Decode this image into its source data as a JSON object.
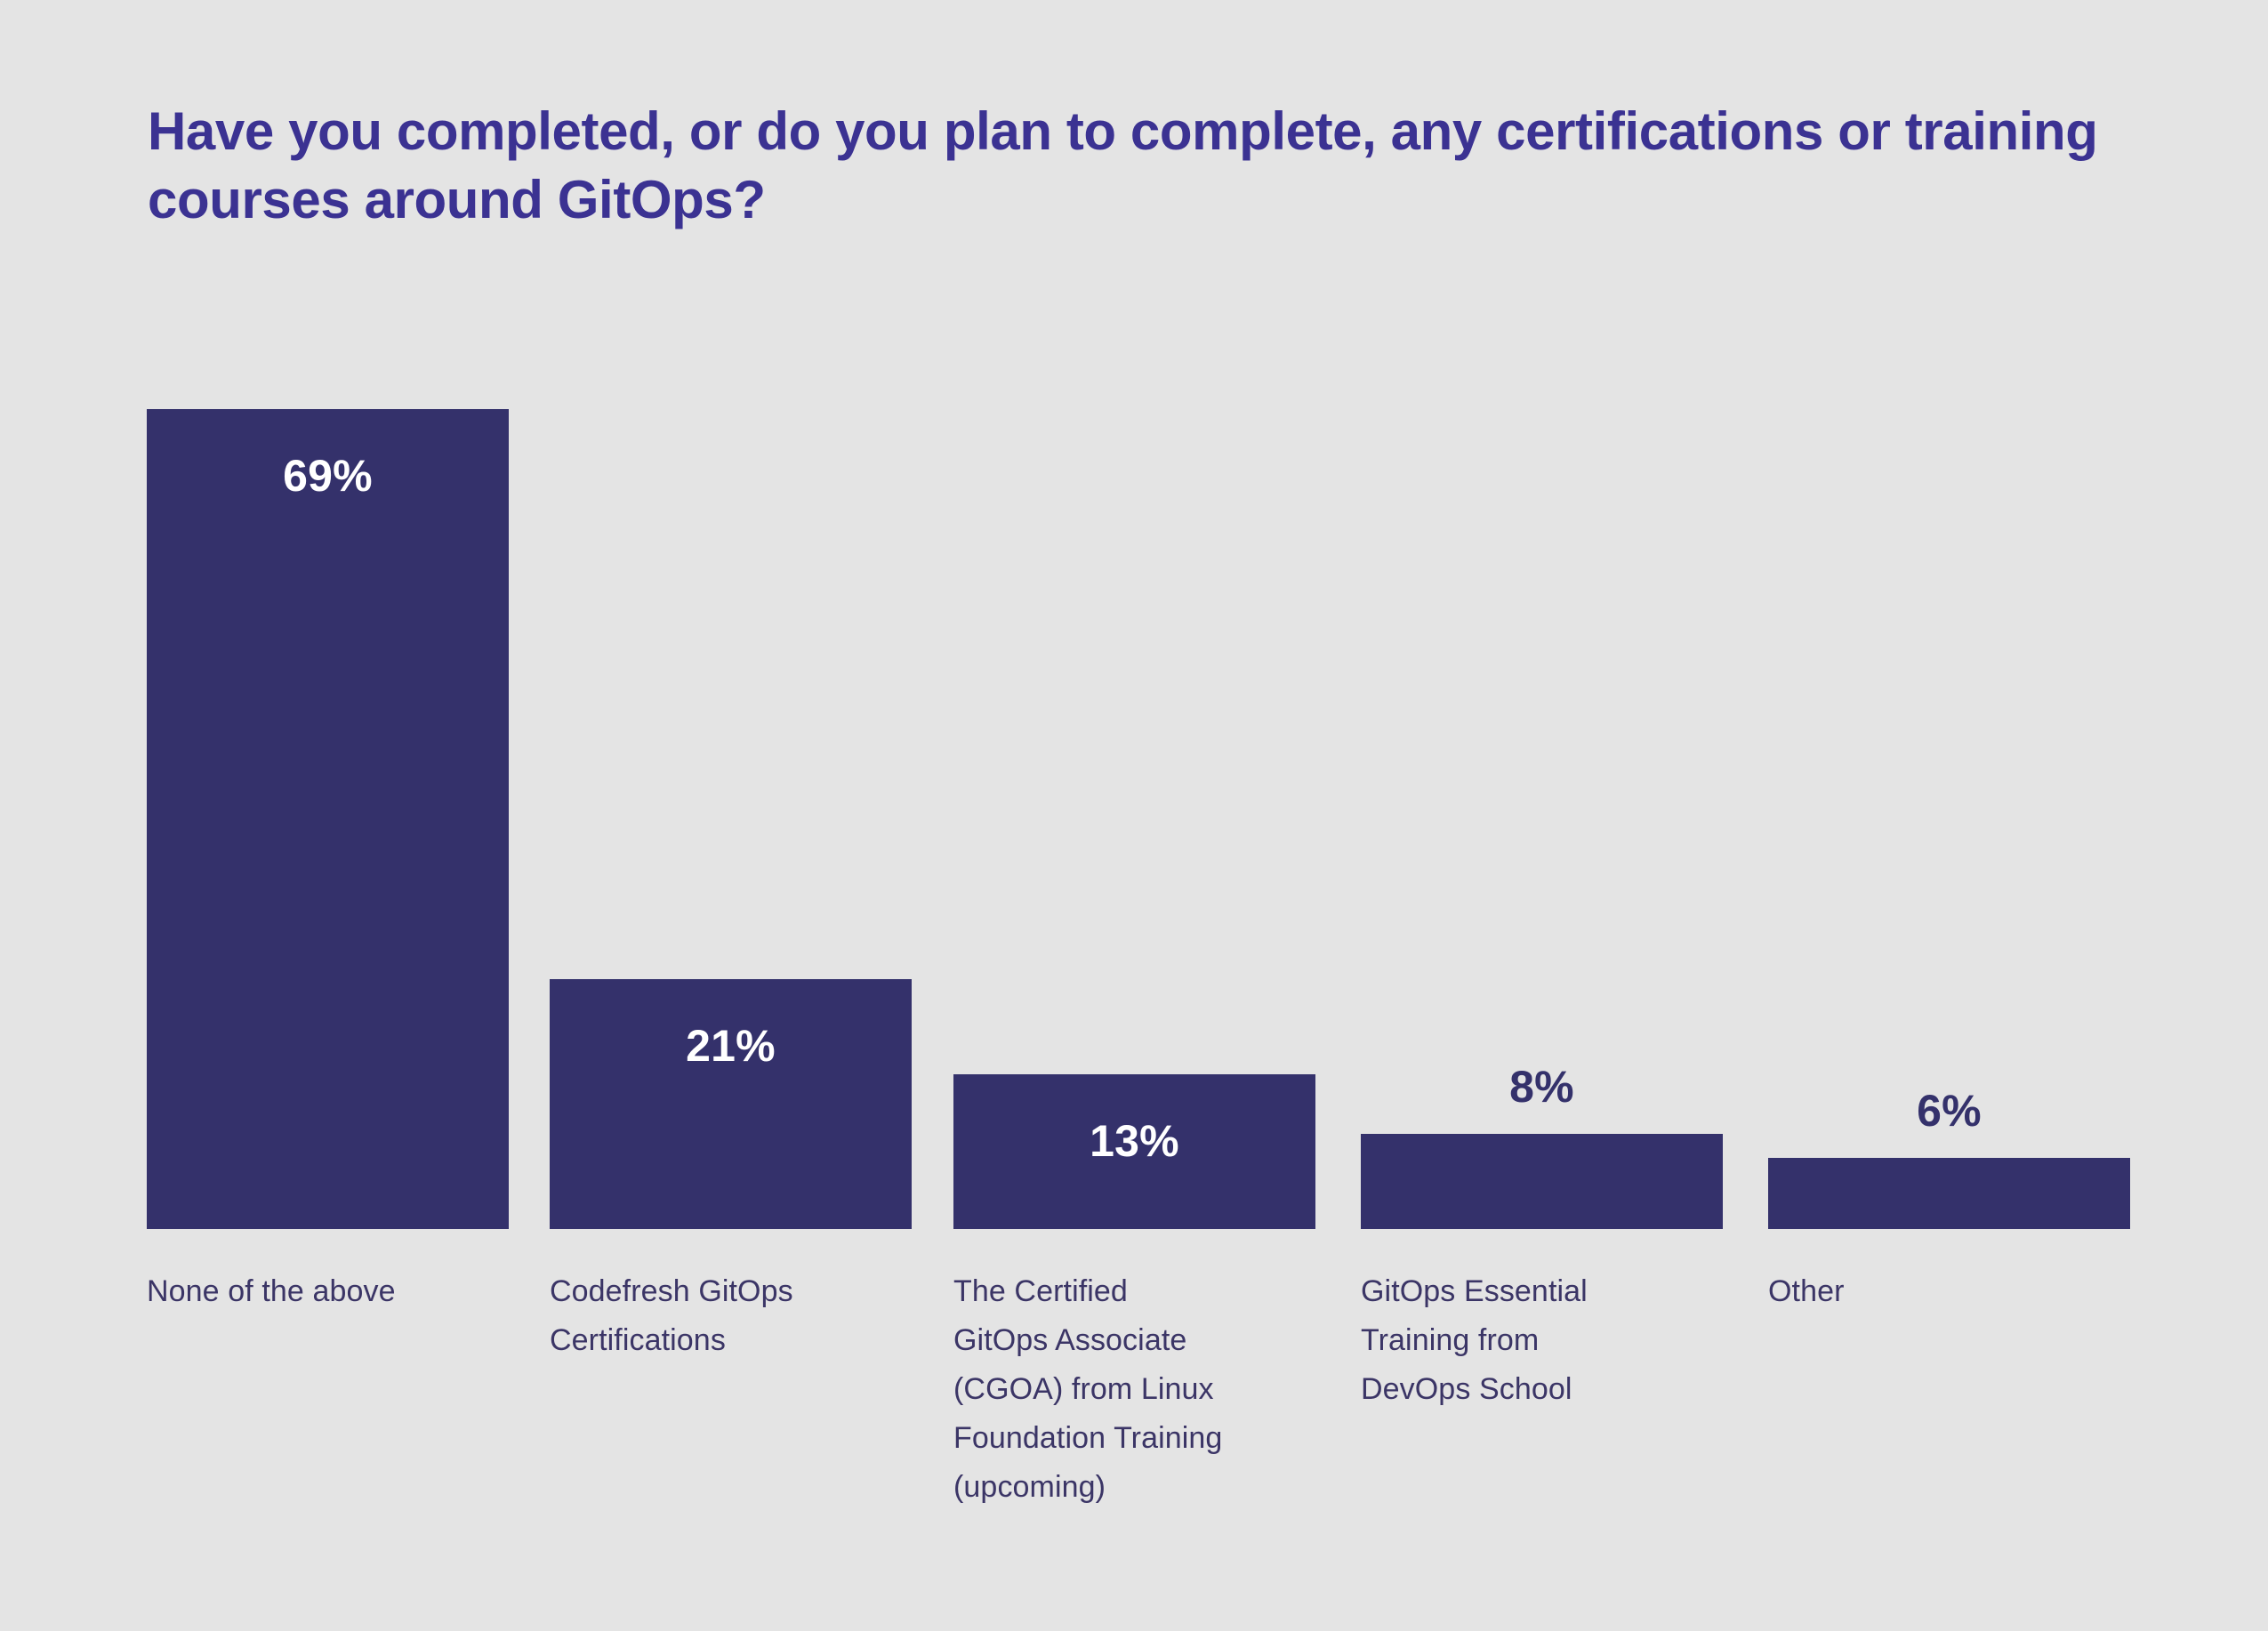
{
  "title": "Have you completed, or do you plan to complete, any certifications or training courses around GitOps?",
  "colors": {
    "background": "#e4e4e4",
    "title": "#3b3292",
    "bar": "#34316b",
    "value_inside": "#ffffff",
    "value_above": "#34316b",
    "category_label": "#3b3566"
  },
  "chart_data": {
    "type": "bar",
    "title": "Have you completed, or do you plan to complete, any certifications or training courses around GitOps?",
    "xlabel": "",
    "ylabel": "",
    "ylim": [
      0,
      69
    ],
    "grid": false,
    "legend": "none",
    "orientation": "vertical",
    "value_suffix": "%",
    "categories": [
      "None of the above",
      "Codefresh GitOps Certifications",
      "The Certified GitOps Associate (CGOA) from Linux Foundation Training (upcoming)",
      "GitOps Essential Training from DevOps School",
      "Other"
    ],
    "values": [
      69,
      21,
      13,
      8,
      6
    ],
    "value_labels": [
      "69%",
      "21%",
      "13%",
      "8%",
      "6%"
    ],
    "bars": [
      {
        "category": "None of the above",
        "value": 69,
        "value_label": "69%",
        "label_position": "inside",
        "label_lines": [
          "None of the above"
        ]
      },
      {
        "category": "Codefresh GitOps Certifications",
        "value": 21,
        "value_label": "21%",
        "label_position": "inside",
        "label_lines": [
          "Codefresh GitOps",
          "Certifications"
        ]
      },
      {
        "category": "The Certified GitOps Associate (CGOA) from Linux Foundation Training (upcoming)",
        "value": 13,
        "value_label": "13%",
        "label_position": "inside",
        "label_lines": [
          "The Certified",
          "GitOps Associate",
          "(CGOA) from Linux",
          "Foundation Training",
          "(upcoming)"
        ]
      },
      {
        "category": "GitOps Essential Training from DevOps School",
        "value": 8,
        "value_label": "8%",
        "label_position": "above",
        "label_lines": [
          "GitOps Essential",
          "Training from",
          "DevOps School"
        ]
      },
      {
        "category": "Other",
        "value": 6,
        "value_label": "6%",
        "label_position": "above",
        "label_lines": [
          "Other"
        ]
      }
    ]
  }
}
